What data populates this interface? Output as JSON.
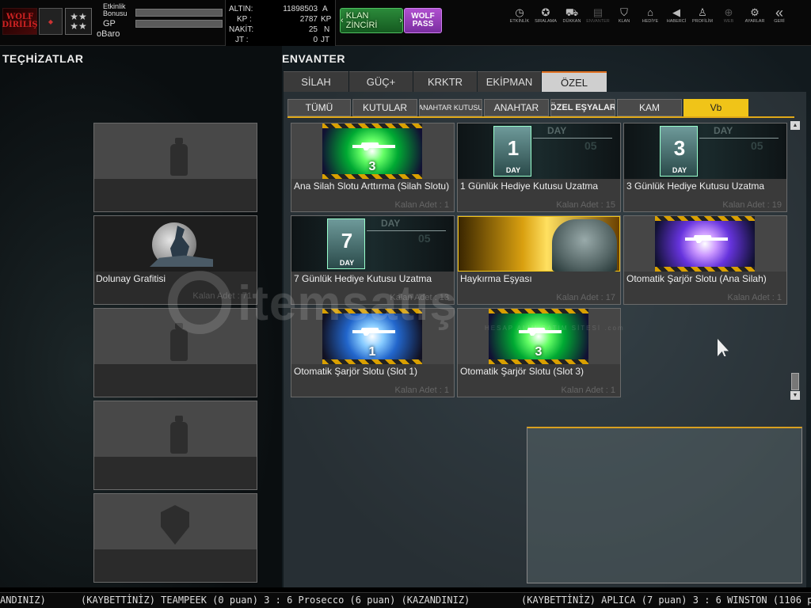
{
  "topbar": {
    "logo_text": "WOLF DİRİLİŞ",
    "bonus_label": "Etkinlik Bonusu",
    "gp_label": "GP",
    "username": "oBaro",
    "stats": [
      {
        "key": "ALTIN:",
        "value": "11898503",
        "unit": "A"
      },
      {
        "key": "KP :",
        "value": "2787",
        "unit": "KP"
      },
      {
        "key": "NAKİT:",
        "value": "25",
        "unit": "N"
      },
      {
        "key": "JT :",
        "value": "0",
        "unit": "JT"
      }
    ],
    "chain_button": "KLAN ZİNCİRİ",
    "wolf_pass_button": "WOLF PASS",
    "menu": [
      {
        "label": "ETKİNLİK",
        "icon": "stopwatch-icon",
        "glyph": "◷"
      },
      {
        "label": "SIRALAMA",
        "icon": "medal-icon",
        "glyph": "✪"
      },
      {
        "label": "DÜKKAN",
        "icon": "cart-icon",
        "glyph": "⛟"
      },
      {
        "label": "ENVANTER",
        "icon": "inventory-icon",
        "glyph": "▤"
      },
      {
        "label": "KLAN",
        "icon": "shield-icon",
        "glyph": "⛉"
      },
      {
        "label": "HEDİYE",
        "icon": "gift-icon",
        "glyph": "⌂"
      },
      {
        "label": "HABERCİ",
        "icon": "megaphone-icon",
        "glyph": "◀"
      },
      {
        "label": "PROFİLİM",
        "icon": "profile-icon",
        "glyph": "♙"
      },
      {
        "label": "WEB",
        "icon": "globe-icon",
        "glyph": "⊕"
      },
      {
        "label": "AYARLAR",
        "icon": "gear-icon",
        "glyph": "⚙"
      },
      {
        "label": "GERİ",
        "icon": "back-icon",
        "glyph": "«"
      }
    ]
  },
  "left": {
    "title": "TEÇHİZATLAR",
    "slots": [
      {
        "type": "spray",
        "name": "",
        "qty": ""
      },
      {
        "type": "moon",
        "name": "Dolunay Grafitisi",
        "qty": "Kalan Adet : 71"
      },
      {
        "type": "spray",
        "name": "",
        "qty": ""
      },
      {
        "type": "spray",
        "name": "",
        "qty": ""
      },
      {
        "type": "shield",
        "name": "",
        "qty": ""
      }
    ]
  },
  "inventory": {
    "title": "ENVANTER",
    "tabs": [
      "SİLAH",
      "GÜÇ+",
      "KRKTR",
      "EKİPMAN",
      "ÖZEL"
    ],
    "active_tab": "ÖZEL",
    "subtabs": [
      "TÜMÜ",
      "KUTULAR",
      "ANAHTAR KUTUSU",
      "ANAHTAR",
      "ÖZEL EŞYALAR",
      "KAM",
      "Vb"
    ],
    "active_subtab": "Vb",
    "items": [
      {
        "name": "Ana Silah Slotu Arttırma (Silah Slotu)",
        "qty": "Kalan Adet : 1",
        "art": "gun-green",
        "num": "3"
      },
      {
        "name": "1 Günlük Hediye Kutusu Uzatma",
        "qty": "Kalan Adet : 15",
        "art": "day",
        "num": "1"
      },
      {
        "name": "3 Günlük Hediye Kutusu Uzatma",
        "qty": "Kalan Adet : 19",
        "art": "day",
        "num": "3"
      },
      {
        "name": "7 Günlük Hediye Kutusu Uzatma",
        "qty": "Kalan Adet : 13",
        "art": "day",
        "num": "7"
      },
      {
        "name": "Haykırma Eşyası",
        "qty": "Kalan Adet : 17",
        "art": "shout",
        "num": ""
      },
      {
        "name": "Otomatik Şarjör Slotu (Ana Silah)",
        "qty": "Kalan Adet : 1",
        "art": "gun-purple",
        "num": ""
      },
      {
        "name": "Otomatik Şarjör Slotu (Slot 1)",
        "qty": "Kalan Adet : 1",
        "art": "gun-blue",
        "num": "1"
      },
      {
        "name": "Otomatik Şarjör Slotu (Slot 3)",
        "qty": "Kalan Adet : 1",
        "art": "gun-green",
        "num": "3"
      }
    ],
    "day_label": "DAY",
    "day_side": "05"
  },
  "ticker": {
    "segments": [
      "ANDINIZ)",
      "(KAYBETTİNİZ) TEAMPEEK (0 puan) 3 : 6 Prosecco (6 puan) (KAZANDINIZ)",
      "(KAYBETTİNİZ) APLICA (7 puan) 3 : 6 WINSTON (1106 p"
    ]
  },
  "watermark": {
    "text": "itemsatış",
    "sub": "HESAP ALIM SATIM SİTESİ .com"
  }
}
